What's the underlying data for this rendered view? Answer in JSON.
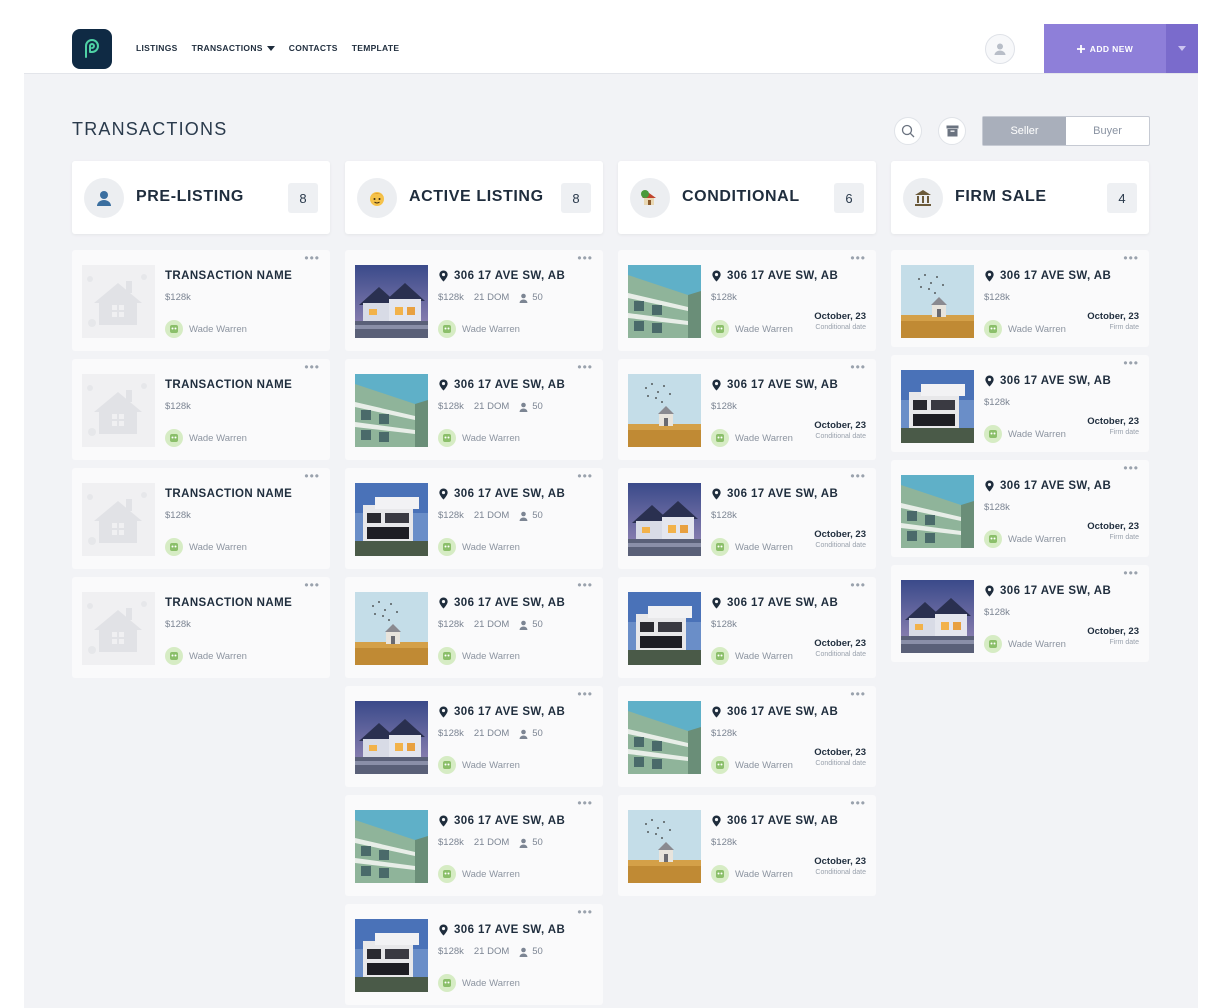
{
  "nav": {
    "items": [
      "LISTINGS",
      "TRANSACTIONS",
      "CONTACTS",
      "TEMPLATE"
    ],
    "add_new_label": "ADD NEW"
  },
  "page": {
    "title": "TRANSACTIONS",
    "toggle_seller": "Seller",
    "toggle_buyer": "Buyer",
    "active_toggle": "Seller"
  },
  "colors": {
    "accent": "#8e7fd9",
    "logo_bg": "#0f2a44"
  },
  "columns": [
    {
      "title": "PRE-LISTING",
      "count": "8",
      "icon": "person-icon",
      "cards": [
        {
          "title": "TRANSACTION NAME",
          "price": "$128k",
          "agent": "Wade Warren",
          "image": "house-placeholder"
        },
        {
          "title": "TRANSACTION NAME",
          "price": "$128k",
          "agent": "Wade Warren",
          "image": "house-placeholder"
        },
        {
          "title": "TRANSACTION NAME",
          "price": "$128k",
          "agent": "Wade Warren",
          "image": "house-placeholder"
        },
        {
          "title": "TRANSACTION NAME",
          "price": "$128k",
          "agent": "Wade Warren",
          "image": "house-placeholder"
        }
      ]
    },
    {
      "title": "ACTIVE LISTING",
      "count": "8",
      "icon": "face-icon",
      "cards": [
        {
          "title": "306 17 AVE SW,  AB",
          "price": "$128k",
          "dom": "21 DOM",
          "people": "50",
          "agent": "Wade Warren",
          "image": "house-dusk"
        },
        {
          "title": "306 17 AVE SW,  AB",
          "price": "$128k",
          "dom": "21 DOM",
          "people": "50",
          "agent": "Wade Warren",
          "image": "apartment-green"
        },
        {
          "title": "306 17 AVE SW,  AB",
          "price": "$128k",
          "dom": "21 DOM",
          "people": "50",
          "agent": "Wade Warren",
          "image": "modern-villa"
        },
        {
          "title": "306 17 AVE SW,  AB",
          "price": "$128k",
          "dom": "21 DOM",
          "people": "50",
          "agent": "Wade Warren",
          "image": "field-house"
        },
        {
          "title": "306 17 AVE SW,  AB",
          "price": "$128k",
          "dom": "21 DOM",
          "people": "50",
          "agent": "Wade Warren",
          "image": "house-dusk"
        },
        {
          "title": "306 17 AVE SW,  AB",
          "price": "$128k",
          "dom": "21 DOM",
          "people": "50",
          "agent": "Wade Warren",
          "image": "apartment-green"
        },
        {
          "title": "306 17 AVE SW,  AB",
          "price": "$128k",
          "dom": "21 DOM",
          "people": "50",
          "agent": "Wade Warren",
          "image": "modern-villa"
        }
      ]
    },
    {
      "title": "CONDITIONAL",
      "count": "6",
      "icon": "house-tree-icon",
      "cards": [
        {
          "title": "306 17 AVE SW,  AB",
          "price": "$128k",
          "agent": "Wade Warren",
          "date": "October, 23",
          "date_label": "Conditional date",
          "image": "apartment-green"
        },
        {
          "title": "306 17 AVE SW,  AB",
          "price": "$128k",
          "agent": "Wade Warren",
          "date": "October, 23",
          "date_label": "Conditional date",
          "image": "field-house"
        },
        {
          "title": "306 17 AVE SW,  AB",
          "price": "$128k",
          "agent": "Wade Warren",
          "date": "October, 23",
          "date_label": "Conditional date",
          "image": "house-dusk"
        },
        {
          "title": "306 17 AVE SW,  AB",
          "price": "$128k",
          "agent": "Wade Warren",
          "date": "October, 23",
          "date_label": "Conditional date",
          "image": "modern-villa"
        },
        {
          "title": "306 17 AVE SW,  AB",
          "price": "$128k",
          "agent": "Wade Warren",
          "date": "October, 23",
          "date_label": "Conditional date",
          "image": "apartment-green"
        },
        {
          "title": "306 17 AVE SW,  AB",
          "price": "$128k",
          "agent": "Wade Warren",
          "date": "October, 23",
          "date_label": "Conditional date",
          "image": "field-house"
        }
      ]
    },
    {
      "title": "FIRM SALE",
      "count": "4",
      "icon": "bank-icon",
      "cards": [
        {
          "title": "306 17 AVE SW,  AB",
          "price": "$128k",
          "agent": "Wade Warren",
          "date": "October, 23",
          "date_label": "Firm date",
          "image": "field-house"
        },
        {
          "title": "306 17 AVE SW,  AB",
          "price": "$128k",
          "agent": "Wade Warren",
          "date": "October, 23",
          "date_label": "Firm date",
          "image": "modern-villa"
        },
        {
          "title": "306 17 AVE SW,  AB",
          "price": "$128k",
          "agent": "Wade Warren",
          "date": "October, 23",
          "date_label": "Firm date",
          "image": "apartment-green"
        },
        {
          "title": "306 17 AVE SW,  AB",
          "price": "$128k",
          "agent": "Wade Warren",
          "date": "October, 23",
          "date_label": "Firm date",
          "image": "house-dusk"
        }
      ]
    }
  ]
}
